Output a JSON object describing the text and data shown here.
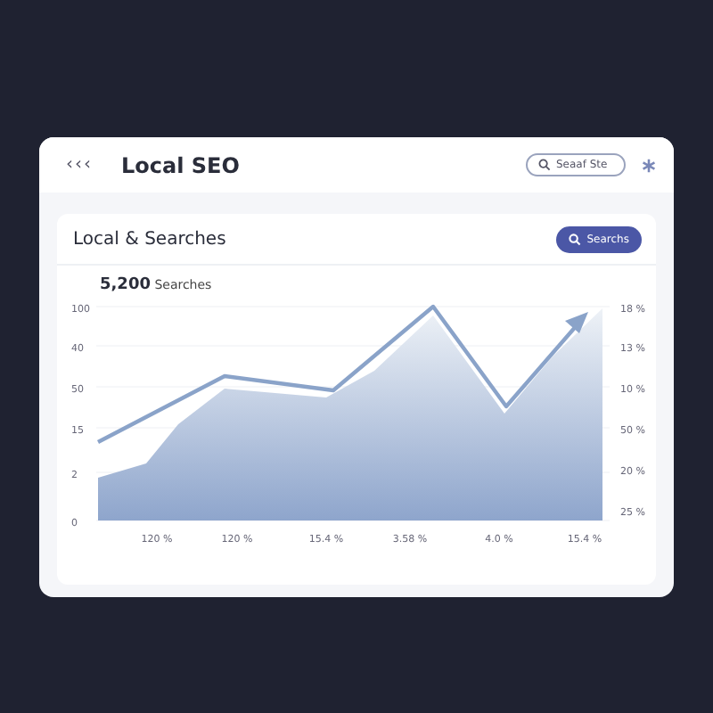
{
  "header": {
    "back": "‹‹‹",
    "title": "Local SEO",
    "search": {
      "placeholder": "Seaaf Ste"
    }
  },
  "panel": {
    "title": "Local & Searches",
    "button": "Searchs",
    "total": "5,200",
    "total_label": "Searches",
    "chart": {
      "left_axis_labels": [
        "100",
        "40",
        "50",
        "15",
        "2",
        "0"
      ],
      "right_axis_labels": [
        "18 %",
        "13 %",
        "10 %",
        "50 %",
        "20 %",
        "25 %"
      ],
      "x_axis_labels": [
        "120 %",
        "120 %",
        "15.4 %",
        "3.58 %",
        "4.0 %",
        "15.4 %"
      ]
    }
  }
}
